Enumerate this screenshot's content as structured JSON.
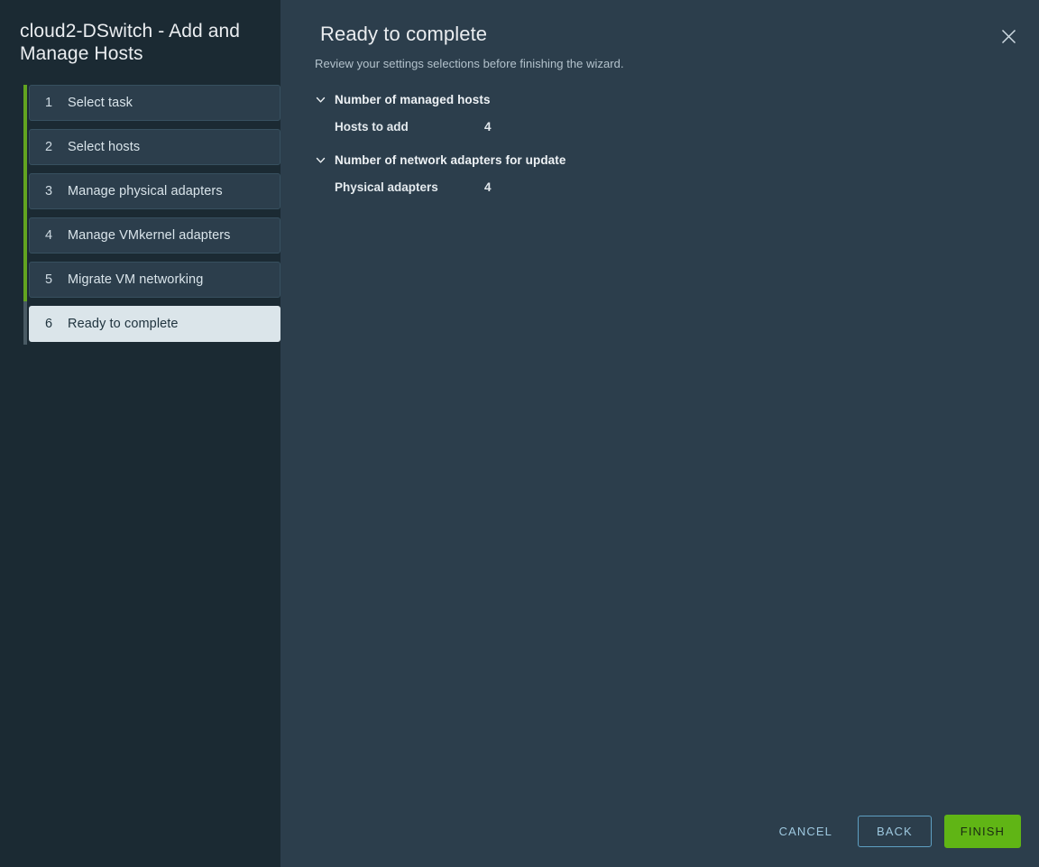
{
  "sidebar": {
    "title": "cloud2-DSwitch - Add and Manage Hosts",
    "steps": [
      {
        "num": "1",
        "label": "Select task",
        "state": "done"
      },
      {
        "num": "2",
        "label": "Select hosts",
        "state": "done"
      },
      {
        "num": "3",
        "label": "Manage physical adapters",
        "state": "done"
      },
      {
        "num": "4",
        "label": "Manage VMkernel adapters",
        "state": "done"
      },
      {
        "num": "5",
        "label": "Migrate VM networking",
        "state": "done"
      },
      {
        "num": "6",
        "label": "Ready to complete",
        "state": "active"
      }
    ]
  },
  "header": {
    "title": "Ready to complete",
    "subtitle": "Review your settings selections before finishing the wizard.",
    "close_icon": "close-icon"
  },
  "sections": [
    {
      "title": "Number of managed hosts",
      "icon": "chevron-down-icon",
      "expanded": true,
      "rows": [
        {
          "label": "Hosts to add",
          "value": "4"
        }
      ]
    },
    {
      "title": "Number of network adapters for update",
      "icon": "chevron-down-icon",
      "expanded": true,
      "rows": [
        {
          "label": "Physical adapters",
          "value": "4"
        }
      ]
    }
  ],
  "footer": {
    "cancel_label": "CANCEL",
    "back_label": "BACK",
    "finish_label": "FINISH"
  },
  "colors": {
    "sidebar_bg": "#1b2a33",
    "panel_bg": "#2c3e4c",
    "step_bg": "#2c3e4c",
    "step_active_bg": "#dbe5ea",
    "progress_green": "#62a420",
    "progress_current": "#495a64",
    "accent_blue": "#9ec8df",
    "primary_green": "#60b515"
  }
}
